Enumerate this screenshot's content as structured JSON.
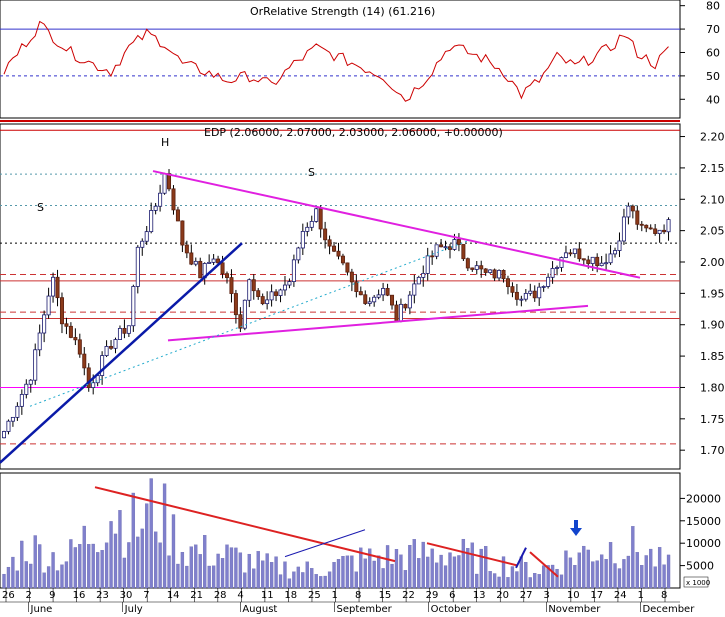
{
  "rsi_panel": {
    "title": "OrRelative Strength (14) (61.216)",
    "ticks": [
      "40",
      "50",
      "60",
      "70",
      "80"
    ]
  },
  "price_panel": {
    "title": "EDP (2.06000, 2.07000, 2.03000, 2.06000, +0.00000)",
    "ticks": [
      "1.70",
      "1.75",
      "1.80",
      "1.85",
      "1.90",
      "1.95",
      "2.00",
      "2.05",
      "2.10",
      "2.15",
      "2.20"
    ],
    "pattern_labels": [
      "S",
      "H",
      "S"
    ]
  },
  "volume_panel": {
    "ticks": [
      "5000",
      "10000",
      "15000",
      "20000"
    ],
    "scale_note": "x 1000"
  },
  "date_axis": {
    "days": [
      "26",
      "2",
      "9",
      "16",
      "23",
      "30",
      "7",
      "14",
      "21",
      "28",
      "4",
      "11",
      "18",
      "25",
      "1",
      "8",
      "15",
      "22",
      "29",
      "6",
      "13",
      "20",
      "27",
      "3",
      "10",
      "17",
      "24",
      "1",
      "8"
    ],
    "months": [
      "June",
      "July",
      "August",
      "September",
      "October",
      "November",
      "December"
    ]
  },
  "chart_data": {
    "type": "candlestick",
    "x_range": [
      "26 May",
      "8 Dec"
    ],
    "price": {
      "ylim": [
        1.67,
        2.22
      ],
      "last": {
        "open": 2.06,
        "high": 2.07,
        "low": 2.03,
        "close": 2.06,
        "change": 0.0
      },
      "horizontal_levels": [
        {
          "value": 1.8,
          "color": "#ff00ff",
          "style": "solid"
        },
        {
          "value": 1.91,
          "color": "#cc3333",
          "style": "solid"
        },
        {
          "value": 1.92,
          "color": "#cc3333",
          "style": "dashed"
        },
        {
          "value": 1.97,
          "color": "#cc3333",
          "style": "solid"
        },
        {
          "value": 1.98,
          "color": "#cc3333",
          "style": "dashed"
        },
        {
          "value": 1.71,
          "color": "#cc3333",
          "style": "dashed"
        },
        {
          "value": 2.14,
          "color": "#5599aa",
          "style": "dotted"
        },
        {
          "value": 2.09,
          "color": "#5599aa",
          "style": "dotted"
        },
        {
          "value": 2.03,
          "color": "#000000",
          "style": "dotted"
        },
        {
          "value": 2.21,
          "color": "#cc0000",
          "style": "solid"
        }
      ]
    },
    "rsi": {
      "ylim": [
        32,
        82
      ],
      "upper": 70,
      "lower": 50,
      "last": 61.216
    },
    "volume": {
      "ylim": [
        0,
        25000
      ],
      "unit": "shares",
      "max": 23000
    }
  }
}
